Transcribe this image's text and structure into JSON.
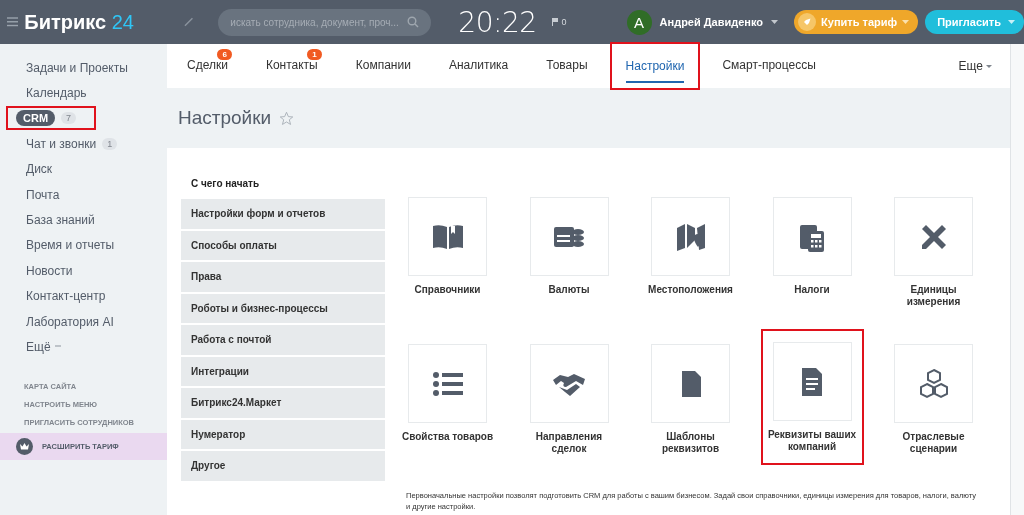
{
  "header": {
    "logo": {
      "name": "Битрикс",
      "number": "24"
    },
    "search": {
      "placeholder": "искать сотрудника, документ, проч..."
    },
    "clock": "20:22",
    "flags": "0",
    "user": {
      "initial": "A",
      "name": "Андрей Давиденко"
    },
    "buy_button": "Купить тариф",
    "invite_button": "Пригласить"
  },
  "sidebar": {
    "items": [
      {
        "label": "Задачи и Проекты",
        "selected": false,
        "highlighted": false
      },
      {
        "label": "Календарь",
        "selected": false,
        "highlighted": false
      },
      {
        "label": "CRM",
        "counter": "7",
        "selected": true,
        "highlighted": true
      },
      {
        "label": "Чат и звонки",
        "counter": "1",
        "selected": false,
        "highlighted": false
      },
      {
        "label": "Диск",
        "selected": false,
        "highlighted": false
      },
      {
        "label": "Почта",
        "selected": false,
        "highlighted": false
      },
      {
        "label": "База знаний",
        "selected": false,
        "highlighted": false
      },
      {
        "label": "Время и отчеты",
        "selected": false,
        "highlighted": false
      },
      {
        "label": "Новости",
        "selected": false,
        "highlighted": false
      },
      {
        "label": "Контакт-центр",
        "selected": false,
        "highlighted": false
      },
      {
        "label": "Лаборатория AI",
        "selected": false,
        "highlighted": false
      }
    ],
    "more": "Ещё",
    "links": [
      "КАРТА САЙТА",
      "НАСТРОИТЬ МЕНЮ",
      "ПРИГЛАСИТЬ СОТРУДНИКОВ"
    ],
    "upgrade": "РАСШИРИТЬ ТАРИФ"
  },
  "tabs": [
    {
      "label": "Сделки",
      "badge": "6",
      "selected": false,
      "highlighted": false
    },
    {
      "label": "Контакты",
      "badge": "1",
      "selected": false,
      "highlighted": false
    },
    {
      "label": "Компании",
      "selected": false,
      "highlighted": false
    },
    {
      "label": "Аналитика",
      "selected": false,
      "highlighted": false
    },
    {
      "label": "Товары",
      "selected": false,
      "highlighted": false
    },
    {
      "label": "Настройки",
      "selected": true,
      "highlighted": true
    },
    {
      "label": "Смарт-процессы",
      "selected": false,
      "highlighted": false
    }
  ],
  "tabs_more": "Еще",
  "page_title": "Настройки",
  "settings_menu": {
    "heading": "С чего начать",
    "items": [
      "Настройки форм и отчетов",
      "Способы оплаты",
      "Права",
      "Роботы и бизнес-процессы",
      "Работа с почтой",
      "Интеграции",
      "Битрикс24.Маркет",
      "Нумератор",
      "Другое"
    ]
  },
  "tiles": [
    {
      "label": "Справочники",
      "highlighted": false
    },
    {
      "label": "Валюты",
      "highlighted": false
    },
    {
      "label": "Местоположения",
      "highlighted": false
    },
    {
      "label": "Налоги",
      "highlighted": false
    },
    {
      "label": "Единицы измерения",
      "highlighted": false
    },
    {
      "label": "Свойства товаров",
      "highlighted": false
    },
    {
      "label": "Направления сделок",
      "highlighted": false
    },
    {
      "label": "Шаблоны реквизитов",
      "highlighted": false
    },
    {
      "label": "Реквизиты ваших компаний",
      "highlighted": true
    },
    {
      "label": "Отраслевые сценарии",
      "highlighted": false
    }
  ],
  "footer_note": "Первоначальные настройки позволят подготовить CRM для работы с вашим бизнесом. Задай свои справочники, единицы измерения для товаров, налоги, валюту и другие настройки."
}
